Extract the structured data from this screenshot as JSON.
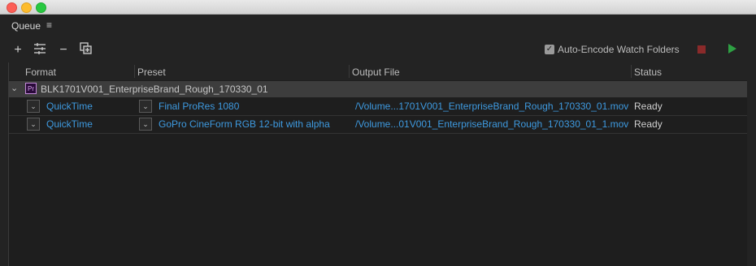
{
  "panel": {
    "title": "Queue"
  },
  "toolbar": {
    "auto_encode_label": "Auto-Encode Watch Folders"
  },
  "columns": {
    "format": "Format",
    "preset": "Preset",
    "output": "Output File",
    "status": "Status"
  },
  "group": {
    "name": "BLK1701V001_EnterpriseBrand_Rough_170330_01",
    "icon_text": "Pr"
  },
  "rows": [
    {
      "format": "QuickTime",
      "preset": "Final ProRes 1080",
      "output": "/Volume...1701V001_EnterpriseBrand_Rough_170330_01.mov",
      "status": "Ready"
    },
    {
      "format": "QuickTime",
      "preset": "GoPro CineForm RGB 12-bit with alpha",
      "output": "/Volume...01V001_EnterpriseBrand_Rough_170330_01_1.mov",
      "status": "Ready"
    }
  ],
  "colors": {
    "accent_link": "#3e9ae0",
    "stop": "#8a2a2a",
    "play": "#2ea043"
  }
}
